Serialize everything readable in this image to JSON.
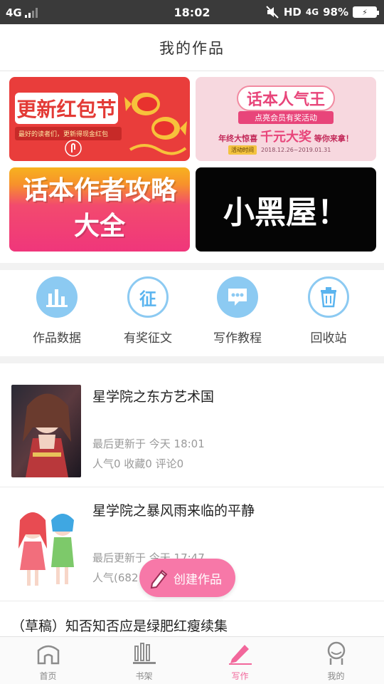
{
  "status_bar": {
    "network": "4G",
    "time": "18:02",
    "hd": "HD",
    "net2": "4G",
    "battery": "98%"
  },
  "header": {
    "title": "我的作品"
  },
  "banners": {
    "b1": {
      "title": "更新红包节",
      "subtitle": "最好的读者们，更新得现金红包"
    },
    "b2": {
      "title": "话本人气王",
      "ribbon": "点亮会员有奖活动",
      "line_pre": "年终大惊喜",
      "line_big": "千元大奖",
      "line_post": "等你来拿！",
      "tag": "活动时间",
      "date": "2018.12.26~2019.01.31"
    },
    "b3": {
      "line1": "话本作者攻略",
      "line2": "大全"
    },
    "b4": {
      "title": "小黑屋！"
    }
  },
  "quick_menu": [
    {
      "label": "作品数据",
      "icon": "bar-chart-icon"
    },
    {
      "label": "有奖征文",
      "icon": "contest-icon",
      "glyph": "征"
    },
    {
      "label": "写作教程",
      "icon": "chat-tutorial-icon"
    },
    {
      "label": "回收站",
      "icon": "trash-icon"
    }
  ],
  "works": [
    {
      "title": "星学院之东方艺术国",
      "update": "最后更新于 今天 18:01",
      "stats": "人气0 收藏0 评论0"
    },
    {
      "title": "星学院之暴风雨来临的平静",
      "update": "最后更新于 今天 17:47",
      "stats": "人气(682"
    }
  ],
  "draft": {
    "title": "（草稿）知否知否应是绿肥红瘦续集"
  },
  "fab": {
    "label": "创建作品",
    "icon": "pencil-icon"
  },
  "tabs": [
    {
      "label": "首页",
      "icon": "home-icon"
    },
    {
      "label": "书架",
      "icon": "bookshelf-icon"
    },
    {
      "label": "写作",
      "icon": "write-icon",
      "active": true
    },
    {
      "label": "我的",
      "icon": "profile-icon"
    }
  ],
  "colors": {
    "accent": "#f2679b",
    "icon_blue": "#5ab4ef",
    "status_bar": "#3a3a3a"
  }
}
